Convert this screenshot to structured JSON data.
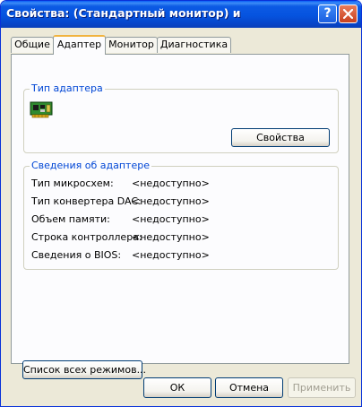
{
  "window": {
    "title": "Свойства: (Стандартный монитор) и",
    "help_glyph": "?",
    "icons": {
      "help": "help-icon",
      "close": "close-icon"
    }
  },
  "tabs": [
    {
      "label": "Общие",
      "active": false
    },
    {
      "label": "Адаптер",
      "active": true
    },
    {
      "label": "Монитор",
      "active": false
    },
    {
      "label": "Диагностика",
      "active": false
    }
  ],
  "adapter_type": {
    "title": "Тип адаптера",
    "icon": "video-card-icon",
    "properties_button": "Свойства"
  },
  "adapter_info": {
    "title": "Сведения об адаптере",
    "rows": [
      {
        "label": "Тип микросхем:",
        "value": "<недоступно>"
      },
      {
        "label": "Тип конвертера DAC:",
        "value": "<недоступно>"
      },
      {
        "label": "Объем памяти:",
        "value": "<недоступно>"
      },
      {
        "label": "Строка контроллера:",
        "value": "<недоступно>"
      },
      {
        "label": "Сведения о BIOS:",
        "value": "<недоступно>"
      }
    ]
  },
  "list_modes_button": "Список всех режимов...",
  "dialog_buttons": {
    "ok": "ОК",
    "cancel": "Отмена",
    "apply": "Применить",
    "apply_enabled": false
  },
  "colors": {
    "title_bar": "#0553df",
    "group_title": "#0046d5",
    "active_tab_accent": "#f1b33f",
    "close_button": "#c8401e"
  }
}
